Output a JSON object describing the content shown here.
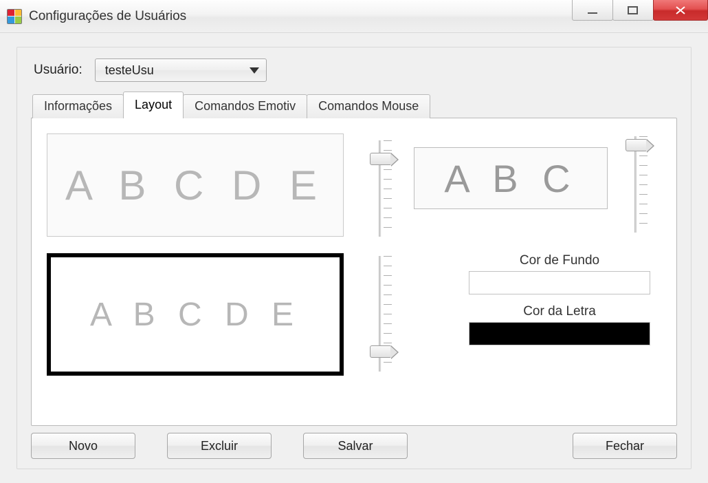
{
  "window": {
    "title": "Configurações de Usuários"
  },
  "user": {
    "label": "Usuário:",
    "selected": "testeUsu"
  },
  "tabs": {
    "items": [
      "Informações",
      "Layout",
      "Comandos Emotiv",
      "Comandos Mouse"
    ],
    "active_index": 1
  },
  "layout_tab": {
    "preview1_text": "A B C D E",
    "preview2_text": "A B C",
    "preview3_text": "A B C D E",
    "slider1_value": 85,
    "slider2_value": 96,
    "slider3_value": 18,
    "bg_label": "Cor de Fundo",
    "bg_color": "#ffffff",
    "fg_label": "Cor da Letra",
    "fg_color": "#000000"
  },
  "buttons": {
    "novo": "Novo",
    "excluir": "Excluir",
    "salvar": "Salvar",
    "fechar": "Fechar"
  }
}
